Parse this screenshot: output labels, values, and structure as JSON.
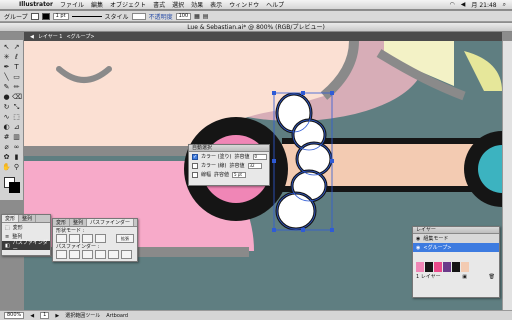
{
  "menubar": {
    "app": "Illustrator",
    "items": [
      "ファイル",
      "編集",
      "オブジェクト",
      "書式",
      "選択",
      "効果",
      "表示",
      "ウィンドウ",
      "ヘルプ"
    ],
    "clock": "月 21:48"
  },
  "control": {
    "selection": "グループ",
    "style_label": "スタイル",
    "opacity_label": "不透明度",
    "opacity_value": "100",
    "stroke_pt": "1 pt",
    "fill_color": "#ffffff",
    "stroke_color": "#000000"
  },
  "document": {
    "title": "Lue & Sebastian.ai* @ 800% (RGB/プレビュー)",
    "breadcrumb_layer": "レイヤー 1",
    "breadcrumb_group": "<グループ>"
  },
  "magic_wand": {
    "title": "自動選択",
    "options": [
      {
        "label": "カラー (塗り)",
        "checked": true,
        "tol_label": "許容値",
        "tol_value": "0"
      },
      {
        "label": "カラー (線)",
        "checked": false,
        "tol_label": "許容値",
        "tol_value": "32"
      },
      {
        "label": "線幅",
        "checked": false,
        "tol_label": "許容値",
        "tol_value": "5 pt"
      }
    ]
  },
  "transform_panel": {
    "tabs": [
      "変形",
      "整列"
    ],
    "items": [
      "変形",
      "整列",
      "パスファインダー"
    ]
  },
  "pathfinder": {
    "tabs": [
      "変形",
      "整列",
      "パスファインダー"
    ],
    "shape_modes_label": "形状モード :",
    "expand_label": "拡張",
    "pathfinders_label": "パスファインダー :"
  },
  "layers": {
    "title": "レイヤー",
    "row1": "組集モード",
    "row2": "<グループ>",
    "count": "1 レイヤー"
  },
  "status": {
    "zoom": "800%",
    "page": "1",
    "tool": "選択範囲ツール",
    "hint": "Artboard"
  },
  "colors": {
    "pink": "#f086b6",
    "black": "#151515",
    "teal": "#5c7f82",
    "peach": "#f7d6c6",
    "selection": "#2f5bd6"
  }
}
